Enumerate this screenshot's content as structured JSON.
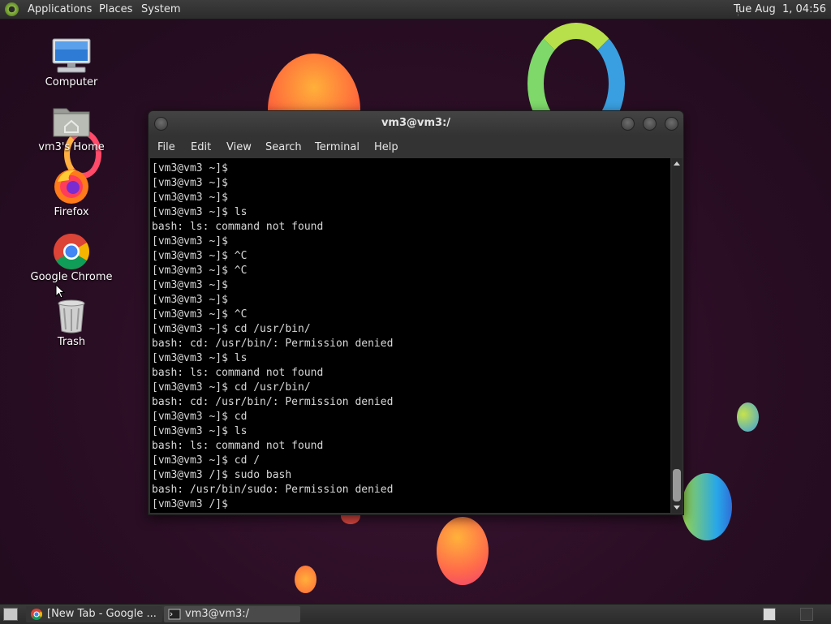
{
  "top_panel": {
    "menus": [
      "Applications",
      "Places",
      "System"
    ],
    "clock": "Tue Aug  1, 04:56"
  },
  "desktop": {
    "icons": [
      {
        "label": "Computer",
        "icon": "computer-icon"
      },
      {
        "label": "vm3's Home",
        "icon": "home-folder-icon"
      },
      {
        "label": "Firefox",
        "icon": "firefox-icon"
      },
      {
        "label": "Google Chrome",
        "icon": "chrome-icon"
      },
      {
        "label": "Trash",
        "icon": "trash-icon"
      }
    ]
  },
  "terminal": {
    "title": "vm3@vm3:/",
    "menu": [
      "File",
      "Edit",
      "View",
      "Search",
      "Terminal",
      "Help"
    ],
    "lines": [
      "[vm3@vm3 ~]$",
      "[vm3@vm3 ~]$",
      "[vm3@vm3 ~]$",
      "[vm3@vm3 ~]$ ls",
      "bash: ls: command not found",
      "[vm3@vm3 ~]$",
      "[vm3@vm3 ~]$ ^C",
      "[vm3@vm3 ~]$ ^C",
      "[vm3@vm3 ~]$",
      "[vm3@vm3 ~]$",
      "[vm3@vm3 ~]$ ^C",
      "[vm3@vm3 ~]$ cd /usr/bin/",
      "bash: cd: /usr/bin/: Permission denied",
      "[vm3@vm3 ~]$ ls",
      "bash: ls: command not found",
      "[vm3@vm3 ~]$ cd /usr/bin/",
      "bash: cd: /usr/bin/: Permission denied",
      "[vm3@vm3 ~]$ cd",
      "[vm3@vm3 ~]$ ls",
      "bash: ls: command not found",
      "[vm3@vm3 ~]$ cd /",
      "[vm3@vm3 /]$ sudo bash",
      "bash: /usr/bin/sudo: Permission denied",
      "[vm3@vm3 /]$"
    ]
  },
  "taskbar": {
    "tasks": [
      {
        "label": "[New Tab - Google ...",
        "icon": "chrome-icon"
      },
      {
        "label": "vm3@vm3:/",
        "icon": "terminal-icon"
      }
    ]
  }
}
